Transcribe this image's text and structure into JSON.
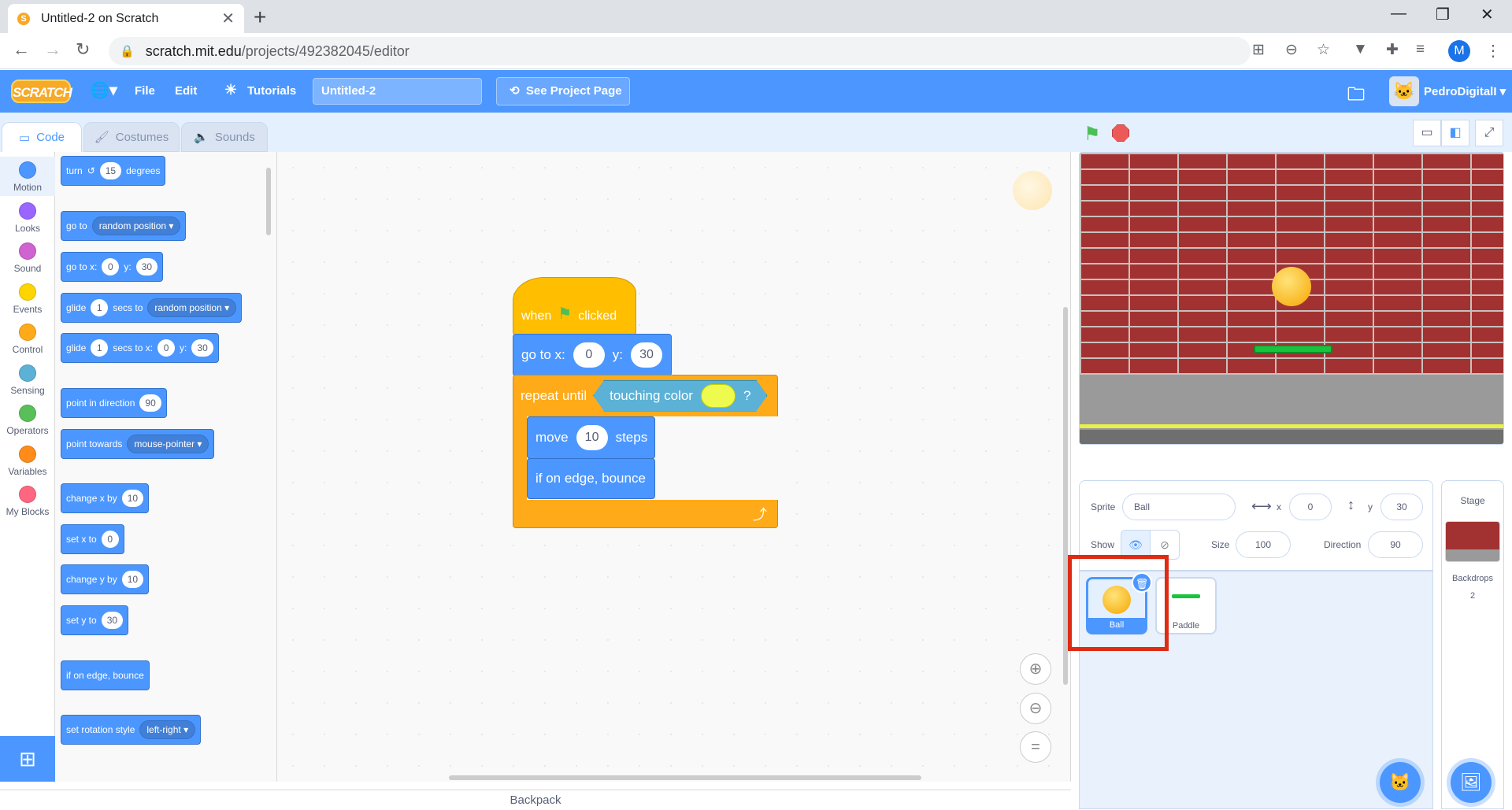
{
  "browser": {
    "tab_title": "Untitled-2 on Scratch",
    "url_domain": "scratch.mit.edu",
    "url_path": "/projects/492382045/editor",
    "profile_initial": "M"
  },
  "menubar": {
    "logo": "SCRATCH",
    "file": "File",
    "edit": "Edit",
    "tutorials": "Tutorials",
    "project_title": "Untitled-2",
    "see_project": "See Project Page",
    "username": "PedroDigitalI"
  },
  "editor_tabs": {
    "code": "Code",
    "costumes": "Costumes",
    "sounds": "Sounds"
  },
  "categories": [
    {
      "label": "Motion",
      "color": "#4c97ff"
    },
    {
      "label": "Looks",
      "color": "#9966ff"
    },
    {
      "label": "Sound",
      "color": "#cf63cf"
    },
    {
      "label": "Events",
      "color": "#ffd500"
    },
    {
      "label": "Control",
      "color": "#ffab19"
    },
    {
      "label": "Sensing",
      "color": "#5cb1d6"
    },
    {
      "label": "Operators",
      "color": "#59c059"
    },
    {
      "label": "Variables",
      "color": "#ff8c1a"
    },
    {
      "label": "My Blocks",
      "color": "#ff6680"
    }
  ],
  "palette": {
    "turn": "turn",
    "turn_val": "15",
    "degrees": "degrees",
    "goto": "go to",
    "goto_target": "random position",
    "gotoxy": "go to x:",
    "gotoxy_x": "0",
    "y_label": "y:",
    "gotoxy_y": "30",
    "glide": "glide",
    "glide_secs": "1",
    "secs_to": "secs to",
    "glide_target": "random position",
    "glide_secs2": "1",
    "secs_to_x": "secs to x:",
    "glide_x": "0",
    "glide_y": "30",
    "point_dir": "point in direction",
    "point_dir_val": "90",
    "point_towards": "point towards",
    "point_towards_target": "mouse-pointer",
    "change_x": "change x by",
    "change_x_val": "10",
    "set_x": "set x to",
    "set_x_val": "0",
    "change_y": "change y by",
    "change_y_val": "10",
    "set_y": "set y to",
    "set_y_val": "30",
    "edge_bounce": "if on edge, bounce",
    "rotation": "set rotation style",
    "rotation_val": "left-right"
  },
  "script": {
    "when": "when",
    "clicked": "clicked",
    "goto_x": "go to x:",
    "x_val": "0",
    "y": "y:",
    "y_val": "30",
    "repeat_until": "repeat until",
    "touching_color": "touching color",
    "q": "?",
    "move": "move",
    "move_val": "10",
    "steps": "steps",
    "bounce": "if on edge, bounce"
  },
  "backpack": "Backpack",
  "sprite_info": {
    "sprite_label": "Sprite",
    "sprite_name": "Ball",
    "x_label": "x",
    "x_val": "0",
    "y_label": "y",
    "y_val": "30",
    "show_label": "Show",
    "size_label": "Size",
    "size_val": "100",
    "direction_label": "Direction",
    "direction_val": "90"
  },
  "sprites": [
    {
      "name": "Ball",
      "selected": true
    },
    {
      "name": "Paddle",
      "selected": false
    }
  ],
  "stage_panel": {
    "title": "Stage",
    "backdrops_label": "Backdrops",
    "backdrops_count": "2"
  }
}
